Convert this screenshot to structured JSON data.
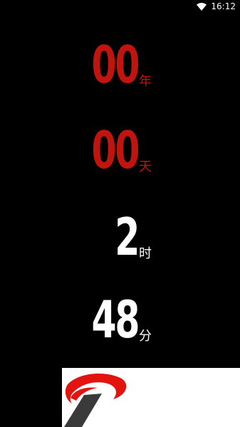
{
  "status_bar": {
    "time": "16:12",
    "icons": [
      "wifi-icon"
    ]
  },
  "counter": {
    "years": {
      "value": "00",
      "unit": "年",
      "color": "#c0140f"
    },
    "days": {
      "value": "00",
      "unit": "天",
      "color": "#c0140f"
    },
    "hours": {
      "value": "2",
      "unit": "时",
      "color": "#ffffff"
    },
    "minutes": {
      "value": "48",
      "unit": "分",
      "color": "#ffffff"
    }
  },
  "logo": {
    "icon": "brand-logo",
    "colors": {
      "swoosh": "#e3140f",
      "bar": "#3a3a3a"
    }
  }
}
